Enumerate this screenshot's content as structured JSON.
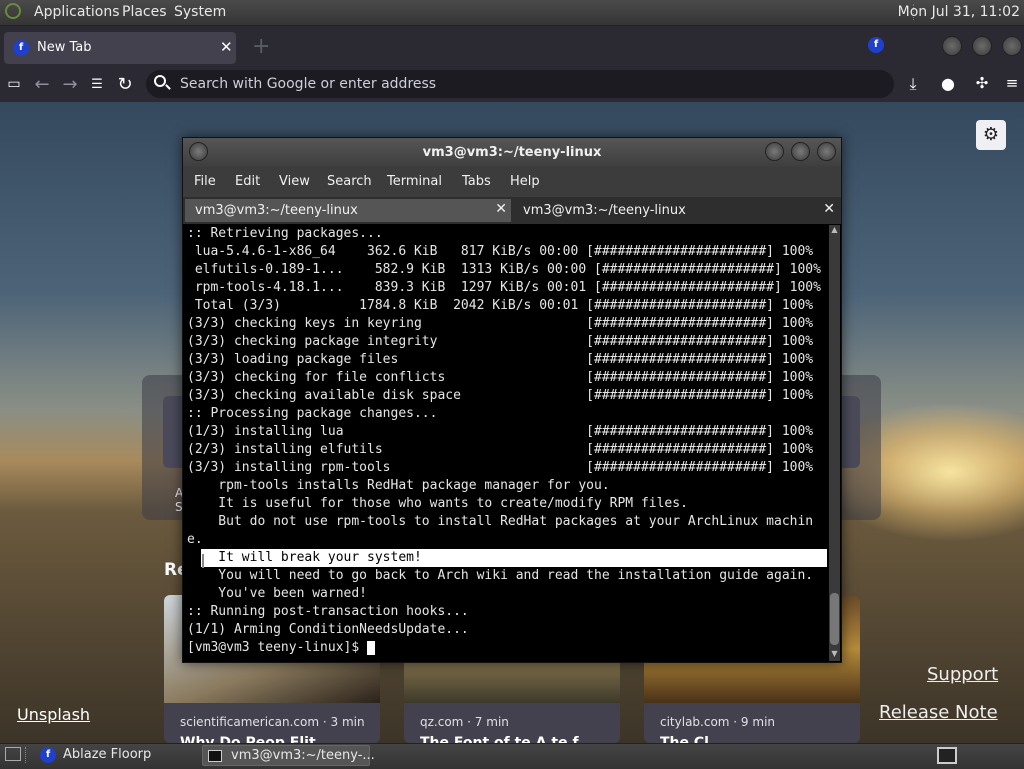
{
  "top_panel": {
    "menus": [
      "Applications",
      "Places",
      "System"
    ],
    "clock": "Mon Jul 31, 11:02",
    "distro_icon": "distro-logo-icon"
  },
  "browser": {
    "tab": {
      "label": "New Tab",
      "close": "✕",
      "icon": "floorp-logo-icon"
    },
    "new_tab_label": "+",
    "urlbar": {
      "placeholder": "Search with Google or enter address",
      "value": ""
    },
    "nav_icons": [
      "sidebar-icon",
      "back-icon",
      "forward-icon",
      "tree-style-tabs-icon",
      "reload-icon"
    ],
    "right_icons": [
      "download-icon",
      "account-icon",
      "extensions-icon",
      "menu-icon"
    ],
    "newtab": {
      "settings_glyph": "⚙",
      "shortcut_fragment_line1": "A",
      "shortcut_fragment_line2": "Sp",
      "recommended_fragment": "Re",
      "stories": [
        {
          "source": "scientificamerican.com · 3 min",
          "title_fragment": "Why Do Peop  Flit"
        },
        {
          "source": "qz.com · 7 min",
          "title_fragment": "The Font of  te  A   te   f"
        },
        {
          "source": "citylab.com · 9 min",
          "title_fragment": "The Cl"
        }
      ],
      "unsplash_link": "Unsplash",
      "support_link": "Support",
      "release_link": "Release Note"
    }
  },
  "terminal": {
    "title": "vm3@vm3:~/teeny-linux",
    "menu": [
      "File",
      "Edit",
      "View",
      "Search",
      "Terminal",
      "Tabs",
      "Help"
    ],
    "tabs": [
      {
        "label": "vm3@vm3:~/teeny-linux",
        "active": true
      },
      {
        "label": "vm3@vm3:~/teeny-linux",
        "active": false
      }
    ],
    "lines": [
      ":: Retrieving packages...",
      " lua-5.4.6-1-x86_64    362.6 KiB   817 KiB/s 00:00 [######################] 100%",
      " elfutils-0.189-1...    582.9 KiB  1313 KiB/s 00:00 [######################] 100%",
      " rpm-tools-4.18.1...    839.3 KiB  1297 KiB/s 00:01 [######################] 100%",
      " Total (3/3)          1784.8 KiB  2042 KiB/s 00:01 [######################] 100%",
      "(3/3) checking keys in keyring                     [######################] 100%",
      "(3/3) checking package integrity                   [######################] 100%",
      "(3/3) loading package files                        [######################] 100%",
      "(3/3) checking for file conflicts                  [######################] 100%",
      "(3/3) checking available disk space                [######################] 100%",
      ":: Processing package changes...",
      "(1/3) installing lua                               [######################] 100%",
      "(2/3) installing elfutils                          [######################] 100%",
      "(3/3) installing rpm-tools                         [######################] 100%",
      "    rpm-tools installs RedHat package manager for you.",
      "    It is useful for those who wants to create/modify RPM files.",
      "    But do not use rpm-tools to install RedHat packages at your ArchLinux machin",
      "e.",
      "    It will break your system!",
      "    You will need to go back to Arch wiki and read the installation guide again.",
      "    You've been warned!",
      ":: Running post-transaction hooks...",
      "(1/1) Arming ConditionNeedsUpdate...",
      "[vm3@vm3 teeny-linux]$ "
    ]
  },
  "bottom_panel": {
    "tasks": [
      {
        "label": "Ablaze Floorp",
        "icon": "floorp-logo-icon"
      },
      {
        "label": "vm3@vm3:~/teeny-...",
        "icon": "terminal-icon"
      }
    ]
  },
  "colors": {
    "floorp_blue": "#1f3fcf",
    "terminal_bg": "#000000",
    "panel_bg": "#3b3b3b"
  }
}
